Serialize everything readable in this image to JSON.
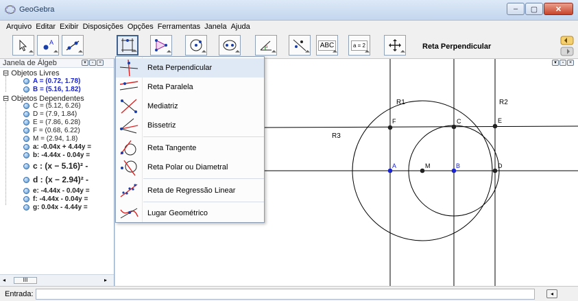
{
  "window": {
    "title": "GeoGebra",
    "minimize": "–",
    "maximize": "▢",
    "close": "✕"
  },
  "menubar": {
    "items": [
      "Arquivo",
      "Editar",
      "Exibir",
      "Disposições",
      "Opções",
      "Ferramentas",
      "Janela",
      "Ajuda"
    ]
  },
  "toolbar": {
    "active_tool_name": "Reta Perpendicular",
    "buttons": [
      "move-tool",
      "point-tool",
      "line-tool",
      "perpendicular-tool",
      "polygon-tool",
      "circle-tool",
      "conic-tool",
      "angle-tool",
      "reflect-tool",
      "text-tool",
      "slider-tool",
      "move-view-tool"
    ],
    "text_button": "ABC",
    "slider_button": "a = 2"
  },
  "algebra": {
    "header": "Janela de Álgeb",
    "free_label": "Objetos Livres",
    "dependent_label": "Objetos Dependentes",
    "free": [
      "A = (0.72, 1.78)",
      "B = (5.16, 1.82)"
    ],
    "dependent": [
      "C = (5.12, 6.26)",
      "D = (7.9, 1.84)",
      "E = (7.86, 6.28)",
      "F = (0.68, 6.22)",
      "M = (2.94, 1.8)",
      "a: -0.04x + 4.44y =",
      "b: -4.44x - 0.04y =",
      "c : (x − 5.16)² -",
      "d : (x − 2.94)² -",
      "e: -4.44x - 0.04y =",
      "f: -4.44x - 0.04y =",
      "g: 0.04x - 4.44y ="
    ],
    "scroll_thumb": "III"
  },
  "tool_menu": {
    "items": [
      "Reta Perpendicular",
      "Reta Paralela",
      "Mediatriz",
      "Bissetriz",
      "Reta Tangente",
      "Reta Polar ou Diametral",
      "Reta de Regressão Linear",
      "Lugar Geométrico"
    ],
    "selected": "Reta Perpendicular"
  },
  "graphics": {
    "labels": {
      "R1": "R1",
      "R2": "R2",
      "R3": "R3",
      "A": "A",
      "B": "B",
      "C": "C",
      "D": "D",
      "E": "E",
      "F": "F",
      "M": "M"
    },
    "colors": {
      "free_point": "#1a23d0",
      "dependent_point": "#222222",
      "line": "#000000"
    }
  },
  "input_bar": {
    "label": "Entrada:",
    "value": "",
    "help": "◂"
  }
}
